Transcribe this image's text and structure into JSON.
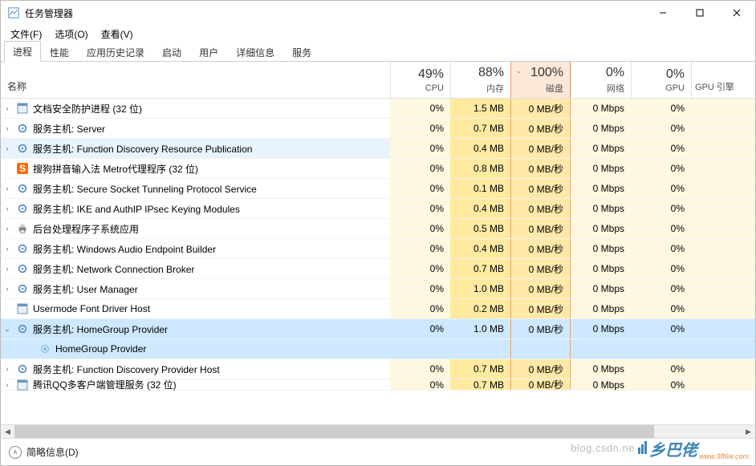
{
  "window": {
    "title": "任务管理器"
  },
  "menu": {
    "file": "文件(F)",
    "options": "选项(O)",
    "view": "查看(V)"
  },
  "tabs": [
    "进程",
    "性能",
    "应用历史记录",
    "启动",
    "用户",
    "详细信息",
    "服务"
  ],
  "activeTab": 0,
  "headers": {
    "name": "名称",
    "cpu_pct": "49%",
    "cpu_lbl": "CPU",
    "mem_pct": "88%",
    "mem_lbl": "内存",
    "disk_pct": "100%",
    "disk_lbl": "磁盘",
    "net_pct": "0%",
    "net_lbl": "网络",
    "gpu_pct": "0%",
    "gpu_lbl": "GPU",
    "gpu_eng": "GPU 引擎"
  },
  "rows": [
    {
      "exp": ">",
      "icon": "app",
      "name": "文档安全防护进程 (32 位)",
      "cpu": "0%",
      "mem": "1.5 MB",
      "disk": "0 MB/秒",
      "net": "0 Mbps",
      "gpu": "0%"
    },
    {
      "exp": ">",
      "icon": "gear",
      "name": "服务主机: Server",
      "cpu": "0%",
      "mem": "0.7 MB",
      "disk": "0 MB/秒",
      "net": "0 Mbps",
      "gpu": "0%"
    },
    {
      "exp": ">",
      "icon": "gear",
      "name": "服务主机: Function Discovery Resource Publication",
      "cpu": "0%",
      "mem": "0.4 MB",
      "disk": "0 MB/秒",
      "net": "0 Mbps",
      "gpu": "0%",
      "hover": true
    },
    {
      "exp": "",
      "icon": "sogou",
      "name": "搜狗拼音输入法 Metro代理程序 (32 位)",
      "cpu": "0%",
      "mem": "0.8 MB",
      "disk": "0 MB/秒",
      "net": "0 Mbps",
      "gpu": "0%"
    },
    {
      "exp": ">",
      "icon": "gear",
      "name": "服务主机: Secure Socket Tunneling Protocol Service",
      "cpu": "0%",
      "mem": "0.1 MB",
      "disk": "0 MB/秒",
      "net": "0 Mbps",
      "gpu": "0%"
    },
    {
      "exp": ">",
      "icon": "gear",
      "name": "服务主机: IKE and AuthIP IPsec Keying Modules",
      "cpu": "0%",
      "mem": "0.4 MB",
      "disk": "0 MB/秒",
      "net": "0 Mbps",
      "gpu": "0%"
    },
    {
      "exp": ">",
      "icon": "print",
      "name": "后台处理程序子系统应用",
      "cpu": "0%",
      "mem": "0.5 MB",
      "disk": "0 MB/秒",
      "net": "0 Mbps",
      "gpu": "0%"
    },
    {
      "exp": ">",
      "icon": "gear",
      "name": "服务主机: Windows Audio Endpoint Builder",
      "cpu": "0%",
      "mem": "0.4 MB",
      "disk": "0 MB/秒",
      "net": "0 Mbps",
      "gpu": "0%"
    },
    {
      "exp": ">",
      "icon": "gear",
      "name": "服务主机: Network Connection Broker",
      "cpu": "0%",
      "mem": "0.7 MB",
      "disk": "0 MB/秒",
      "net": "0 Mbps",
      "gpu": "0%"
    },
    {
      "exp": ">",
      "icon": "gear",
      "name": "服务主机: User Manager",
      "cpu": "0%",
      "mem": "1.0 MB",
      "disk": "0 MB/秒",
      "net": "0 Mbps",
      "gpu": "0%"
    },
    {
      "exp": "",
      "icon": "app",
      "name": "Usermode Font Driver Host",
      "cpu": "0%",
      "mem": "0.2 MB",
      "disk": "0 MB/秒",
      "net": "0 Mbps",
      "gpu": "0%"
    },
    {
      "exp": "v",
      "icon": "gear",
      "name": "服务主机: HomeGroup Provider",
      "cpu": "0%",
      "mem": "1.0 MB",
      "disk": "0 MB/秒",
      "net": "0 Mbps",
      "gpu": "0%",
      "selected": true
    },
    {
      "exp": "",
      "icon": "svc",
      "name": "HomeGroup Provider",
      "child": true,
      "selected": true
    },
    {
      "exp": ">",
      "icon": "gear",
      "name": "服务主机: Function Discovery Provider Host",
      "cpu": "0%",
      "mem": "0.7 MB",
      "disk": "0 MB/秒",
      "net": "0 Mbps",
      "gpu": "0%"
    },
    {
      "exp": ">",
      "icon": "app",
      "name": "腾讯QQ多客户端管理服务 (32 位)",
      "cpu": "0%",
      "mem": "0.7 MB",
      "disk": "0 MB/秒",
      "net": "0 Mbps",
      "gpu": "0%",
      "cut": true
    }
  ],
  "status": {
    "fewer": "简略信息(D)"
  },
  "watermark": {
    "text": "乡巴佬",
    "sub": "www.386w.com"
  },
  "csdn": "blog.csdn.ne"
}
